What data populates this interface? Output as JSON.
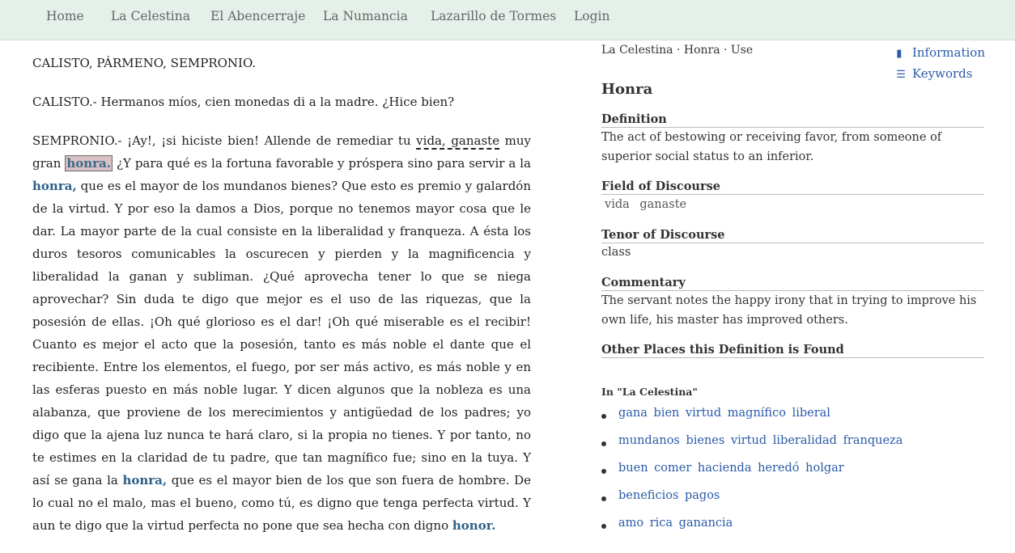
{
  "nav": {
    "home": "Home",
    "celestina": "La Celestina",
    "abencerraje": "El Abencerraje",
    "numancia": "La Numancia",
    "lazarillo": "Lazarillo de Tormes",
    "login": "Login"
  },
  "text": {
    "characters": "CALISTO, PÁRMENO, SEMPRONIO.",
    "calisto": "CALISTO.- Hermanos míos, cien monedas di a la madre. ¿Hice bien?",
    "p3": {
      "a": "SEMPRONIO.- ¡Ay!, ¡si hiciste bien! Allende de remediar tu ",
      "b": "vida, ganaste",
      "c": " muy gran ",
      "d": "honra.",
      "e": " ¿Y para qué es la fortuna favorable y próspera sino para servir a la ",
      "f": "honra,",
      "g": " que es el mayor de los mundanos bienes? Que esto es premio y galardón de la virtud. Y por eso la damos a Dios, porque no tenemos mayor cosa que le dar. La mayor parte de la cual consiste en la liberalidad y franqueza. A ésta los duros tesoros comunicables la oscurecen y pierden y la magnificencia y liberalidad la ganan y subliman. ¿Qué aprovecha tener lo que se niega aprovechar? Sin duda te digo que mejor es el uso de las riquezas, que la posesión de ellas. ¡Oh qué glorioso es el dar! ¡Oh qué miserable es el recibir! Cuanto es mejor el acto que la posesión, tanto es más noble el dante que el recibiente. Entre los elementos, el fuego, por ser más activo, es más noble y en las esferas puesto en más noble lugar. Y dicen algunos que la nobleza es una alabanza, que proviene de los merecimientos y antigüedad de los padres; yo digo que la ajena luz nunca te hará claro, si la propia no tienes. Y por tanto, no te estimes en la claridad de tu padre, que tan magnífico fue; sino en la tuya. Y así se gana la ",
      "h": "honra,",
      "i": " que es el mayor bien de los que son fuera de hombre. De lo cual no el malo, mas el bueno, como tú, es digno que tenga perfecta virtud. Y aun te digo que la virtud perfecta no pone que sea hecha con digno ",
      "j": "honor."
    }
  },
  "side": {
    "breadcrumb": "La Celestina · Honra · Use",
    "info_link": "Information",
    "keywords_link": "Keywords",
    "term": "Honra",
    "definition_h": "Definition",
    "definition": "The act of bestowing or receiving favor, from someone of superior social status to an inferior.",
    "field_h": "Field of Discourse",
    "field_words": [
      "vida",
      "ganaste"
    ],
    "tenor_h": "Tenor of Discourse",
    "tenor": "class",
    "commentary_h": "Commentary",
    "commentary": "The servant notes the happy irony that in trying to improve his own life, his master has improved others.",
    "other_h": "Other Places this Definition is Found",
    "in_label": "In \"La Celestina\"",
    "other_items": [
      "gana bien virtud magnífico liberal",
      "mundanos bienes virtud liberalidad franqueza",
      "buen comer hacienda heredó holgar",
      "beneficios pagos",
      "amo rica ganancia"
    ]
  },
  "icons": {
    "info": "book-icon",
    "keywords": "list-icon"
  }
}
